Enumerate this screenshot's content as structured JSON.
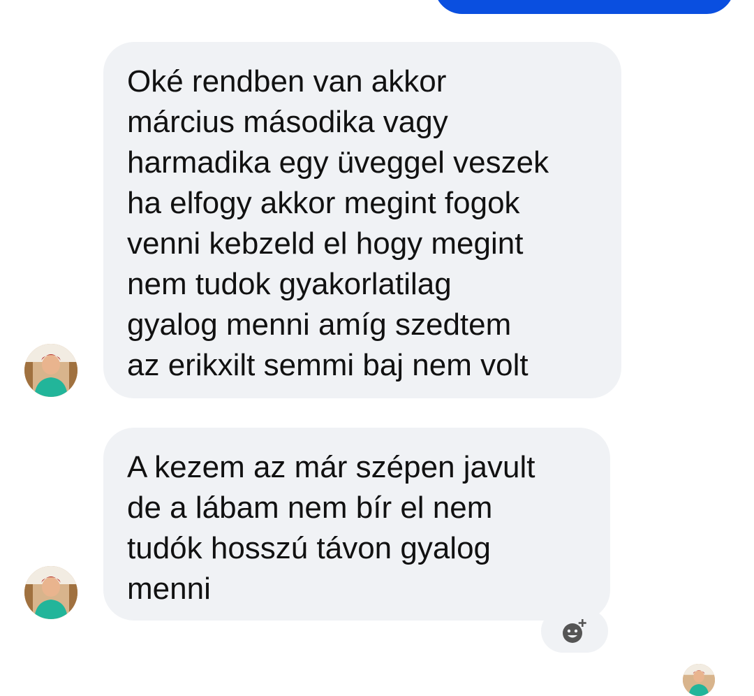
{
  "conversation": {
    "messages": [
      {
        "direction": "received",
        "lines": [
          "Oké rendben van akkor",
          "március másodika vagy",
          "harmadika egy üveggel veszek",
          "ha elfogy akkor megint fogok",
          "venni kebzeld el hogy megint",
          "nem tudok gyakorlatilag",
          "gyalog menni amíg szedtem",
          "az erikxilt semmi baj nem volt"
        ]
      },
      {
        "direction": "received",
        "lines": [
          "A kezem az már szépen javult",
          "de a lábam nem bír el nem",
          "tudók hosszú távon gyalog",
          "menni"
        ]
      }
    ],
    "reaction_button": {
      "icon": "add-reaction-smiley-icon"
    },
    "avatar_icon": "user-avatar-photo"
  },
  "colors": {
    "sent_bubble": "#0a4fe0",
    "received_bubble": "#f0f2f5",
    "text": "#111111",
    "icon": "#555555"
  }
}
